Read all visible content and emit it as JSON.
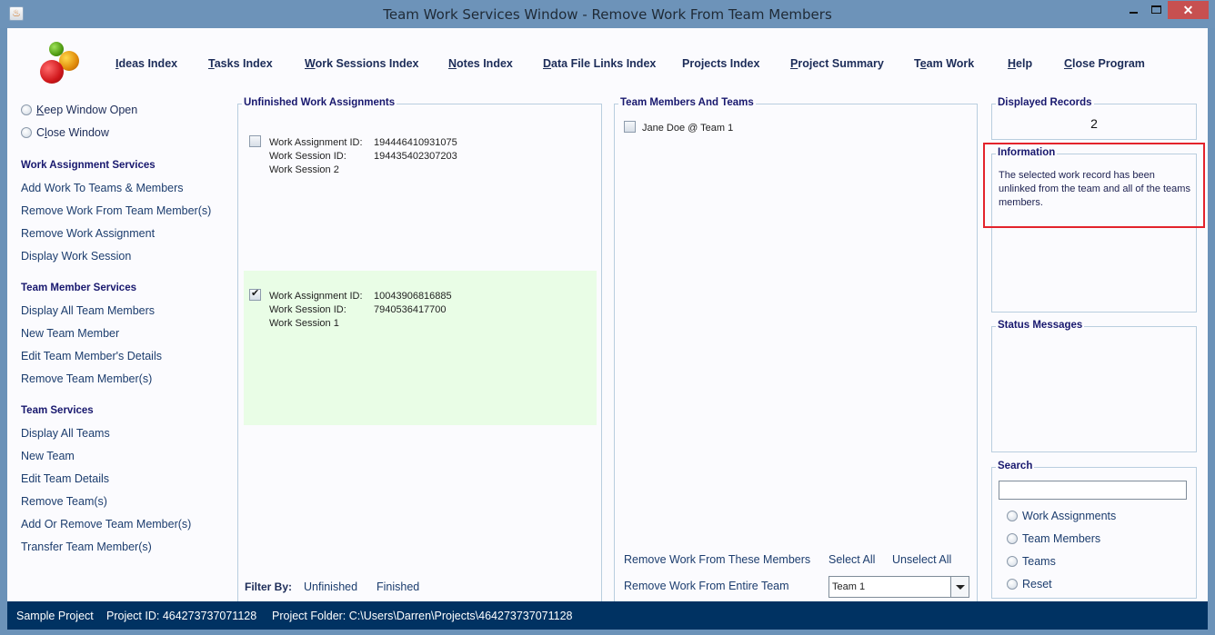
{
  "window": {
    "title": "Team Work Services Window - Remove Work From Team Members",
    "controls": {
      "minimize": "minimize",
      "maximize": "maximize",
      "close": "✕"
    }
  },
  "nav": [
    {
      "label_u": "I",
      "label_rest": "deas Index"
    },
    {
      "label_u": "T",
      "label_rest": "asks Index"
    },
    {
      "label_u": "W",
      "label_rest": "ork Sessions Index"
    },
    {
      "label_u": "N",
      "label_rest": "otes Index"
    },
    {
      "label_u": "D",
      "label_rest": "ata File Links Index"
    },
    {
      "label_u": "",
      "label_rest": "Projects Index"
    },
    {
      "label_u": "P",
      "label_rest": "roject Summary"
    },
    {
      "label_pre": "T",
      "label_u": "e",
      "label_rest": "am Work"
    },
    {
      "label_u": "H",
      "label_rest": "elp"
    },
    {
      "label_u": "C",
      "label_rest": "lose Program"
    }
  ],
  "sidebar": {
    "window_options": [
      {
        "label_u": "K",
        "label_rest": "eep Window Open",
        "selected": false
      },
      {
        "label_pre": "C",
        "label_u": "l",
        "label_rest": "ose Window",
        "selected": false
      }
    ],
    "sections": [
      {
        "heading": "Work Assignment Services",
        "items": [
          "Add Work To Teams & Members",
          "Remove Work From Team Member(s)",
          "Remove Work Assignment",
          "Display Work Session"
        ]
      },
      {
        "heading": "Team Member Services",
        "items": [
          "Display All Team Members",
          "New Team Member",
          "Edit Team Member's Details",
          "Remove Team Member(s)"
        ]
      },
      {
        "heading": "Team Services",
        "items": [
          "Display All Teams",
          "New Team",
          "Edit Team Details",
          "Remove Team(s)",
          "Add Or Remove Team Member(s)",
          "Transfer Team Member(s)"
        ]
      }
    ]
  },
  "work_assignments": {
    "title": "Unfinished Work Assignments",
    "labels": {
      "assignment_id": "Work Assignment ID:",
      "session_id": "Work Session ID:"
    },
    "items": [
      {
        "assignment_id": "194446410931075",
        "session_id": "194435402307203",
        "session_name": "Work Session 2",
        "checked": false
      },
      {
        "assignment_id": "10043906816885",
        "session_id": "7940536417700",
        "session_name": "Work Session 1",
        "checked": true
      }
    ],
    "filter": {
      "label": "Filter By:",
      "options": [
        "Unfinished",
        "Finished"
      ]
    }
  },
  "team_members": {
    "title": "Team Members And Teams",
    "items": [
      {
        "label": "Jane Doe @ Team 1",
        "checked": false
      }
    ],
    "actions": {
      "remove_from_members": "Remove Work From These Members",
      "select_all": "Select All",
      "unselect_all": "Unselect All",
      "remove_from_team": "Remove Work From Entire Team"
    },
    "team_select": {
      "value": "Team 1"
    }
  },
  "displayed_records": {
    "title": "Displayed Records",
    "value": "2"
  },
  "information": {
    "title": "Information",
    "text": "The selected work record has been unlinked from the team and all of the teams members."
  },
  "status_messages": {
    "title": "Status Messages",
    "text": ""
  },
  "search": {
    "title": "Search",
    "value": "",
    "options": [
      "Work Assignments",
      "Team Members",
      "Teams",
      "Reset"
    ]
  },
  "statusbar": {
    "project_name": "Sample Project",
    "project_id": "Project ID:  464273737071128",
    "project_folder": "Project Folder: C:\\Users\\Darren\\Projects\\464273737071128"
  },
  "colors": {
    "title_bar": "#6d93b9",
    "close_button": "#c75050",
    "status_bar": "#003262",
    "heading_text": "#18186e",
    "selected_row": "#e9fde6",
    "highlight_border": "#e3232c"
  }
}
